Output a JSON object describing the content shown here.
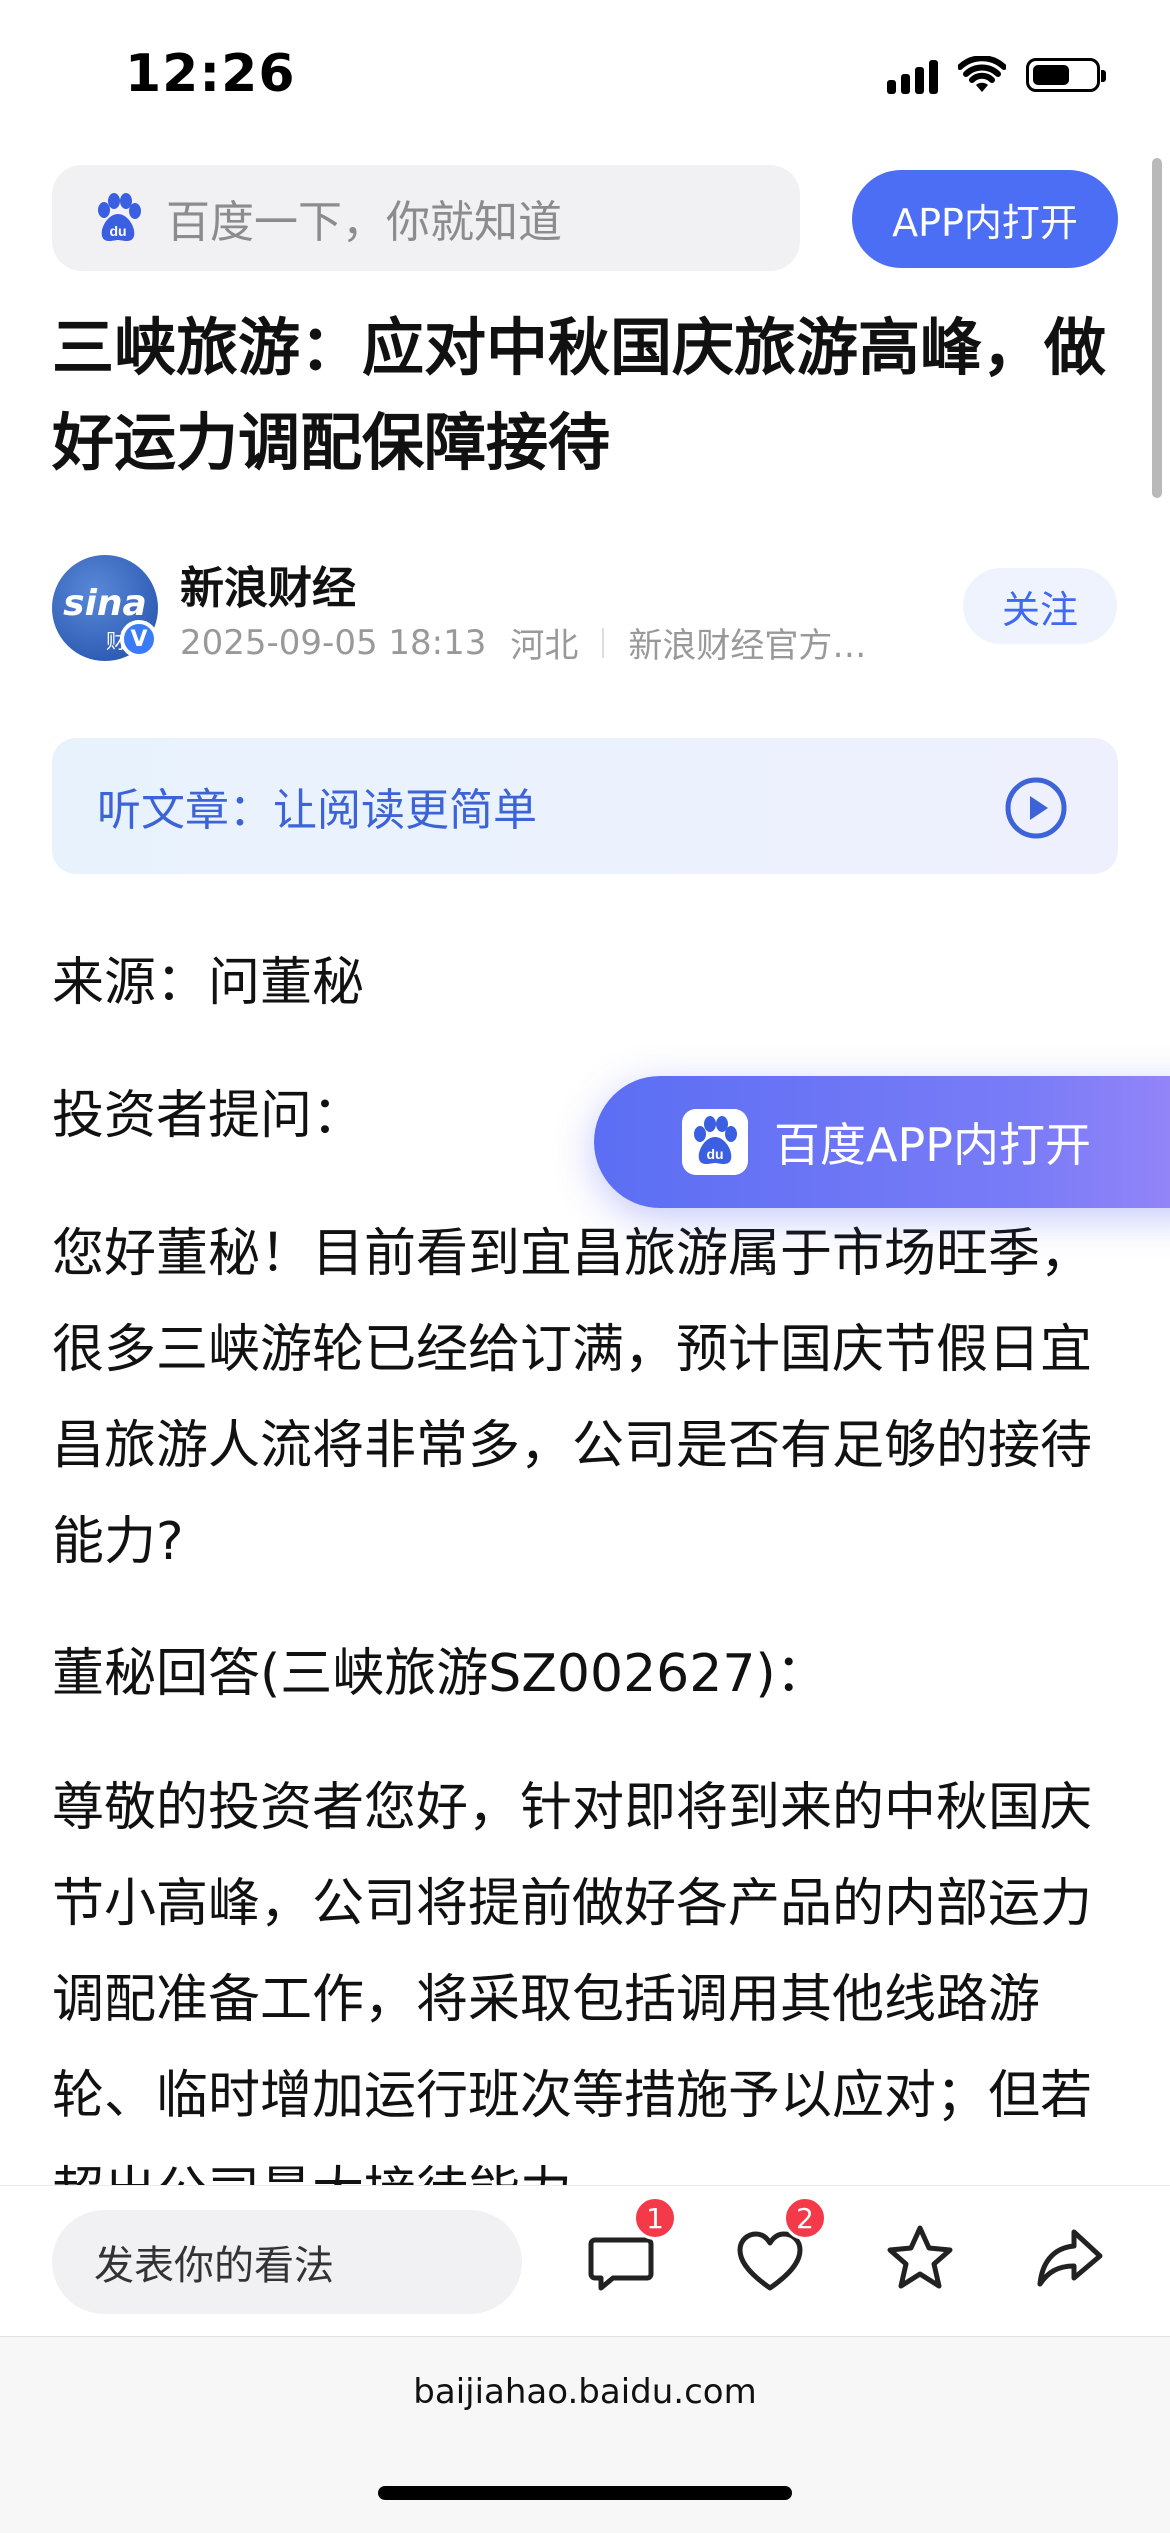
{
  "status_bar": {
    "time": "12:26"
  },
  "search": {
    "placeholder": "百度一下，你就知道",
    "open_app_label": "APP内打开"
  },
  "article": {
    "title": "三峡旅游：应对中秋国庆旅游高峰，做好运力调配保障接待",
    "author": {
      "name": "新浪财经",
      "avatar_text": "sina",
      "avatar_sub": "财",
      "verified_mark": "V",
      "datetime": "2025-09-05 18:13",
      "location": "河北",
      "source": "新浪财经官方…",
      "follow_label": "关注"
    },
    "listen_label": "听文章：让阅读更简单",
    "paragraphs": [
      "来源：问董秘",
      "投资者提问：",
      "您好董秘！目前看到宜昌旅游属于市场旺季，很多三峡游轮已经给订满，预计国庆节假日宜昌旅游人流将非常多，公司是否有足够的接待能力?",
      "董秘回答(三峡旅游SZ002627)：",
      "尊敬的投资者您好，针对即将到来的中秋国庆节小高峰，公司将提前做好各产品的内部运力调配准备工作，将采取包括调用其他线路游轮、临时增加运行班次等措施予以应对；但若超出公司最大接待能力"
    ]
  },
  "floating_button": {
    "label": "百度APP内打开"
  },
  "bottom_bar": {
    "comment_placeholder": "发表你的看法",
    "comment_count": "1",
    "like_count": "2"
  },
  "url": "baijiahao.baidu.com"
}
